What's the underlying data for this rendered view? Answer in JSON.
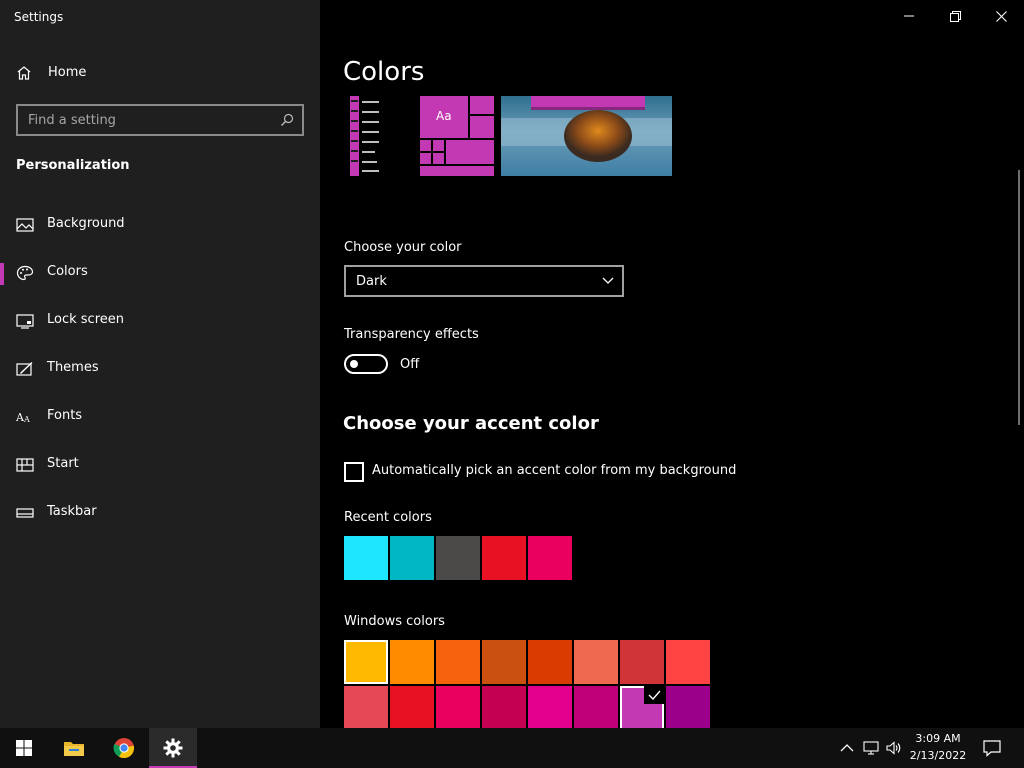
{
  "window": {
    "title": "Settings"
  },
  "sidebar": {
    "home_label": "Home",
    "search_placeholder": "Find a setting",
    "section_title": "Personalization",
    "items": [
      {
        "label": "Background",
        "icon": "picture-icon",
        "selected": false
      },
      {
        "label": "Colors",
        "icon": "palette-icon",
        "selected": true
      },
      {
        "label": "Lock screen",
        "icon": "lock-screen-icon",
        "selected": false
      },
      {
        "label": "Themes",
        "icon": "themes-icon",
        "selected": false
      },
      {
        "label": "Fonts",
        "icon": "fonts-icon",
        "selected": false
      },
      {
        "label": "Start",
        "icon": "start-icon",
        "selected": false
      },
      {
        "label": "Taskbar",
        "icon": "taskbar-icon",
        "selected": false
      }
    ]
  },
  "main": {
    "title": "Colors",
    "preview_tile_text": "Aa",
    "choose_color_label": "Choose your color",
    "choose_color_value": "Dark",
    "transparency_label": "Transparency effects",
    "transparency_state": "Off",
    "accent_title": "Choose your accent color",
    "auto_pick_label": "Automatically pick an accent color from my background",
    "auto_pick_checked": false,
    "recent_colors_label": "Recent colors",
    "recent_colors": [
      "#1ee6ff",
      "#00b7c3",
      "#4c4a48",
      "#e81123",
      "#ea005e"
    ],
    "windows_colors_label": "Windows colors",
    "windows_colors_row1": [
      "#ffb900",
      "#ff8c00",
      "#f7630c",
      "#ca5010",
      "#da3b01",
      "#ef6950",
      "#d13438",
      "#ff4343"
    ],
    "windows_colors_row2": [
      "#e74856",
      "#e81123",
      "#ea005e",
      "#c30052",
      "#e3008c",
      "#bf0077",
      "#c239b3",
      "#9a0089"
    ],
    "selected_windows_color_index": 14,
    "accent_color": "#c239b3"
  },
  "taskbar": {
    "apps": [
      {
        "name": "file-explorer",
        "icon": "folder-icon"
      },
      {
        "name": "chrome",
        "icon": "chrome-icon"
      },
      {
        "name": "settings",
        "icon": "gear-icon",
        "active": true
      }
    ],
    "time": "3:09 AM",
    "date": "2/13/2022"
  }
}
